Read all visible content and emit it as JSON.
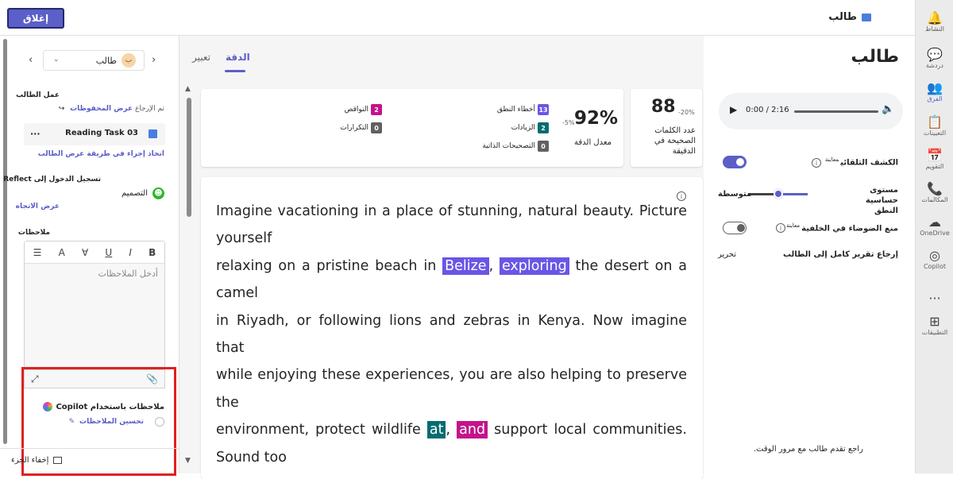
{
  "top_bar": {
    "close_label": "إغلاق",
    "app_title": "طالب"
  },
  "rail": [
    {
      "label": "النشاط",
      "icon": "bell-icon",
      "glyph": "🔔"
    },
    {
      "label": "دردشة",
      "icon": "chat-icon",
      "glyph": "💬"
    },
    {
      "label": "الفرق",
      "icon": "teams-icon",
      "glyph": "👥"
    },
    {
      "label": "التعيينات",
      "icon": "assignments-icon",
      "glyph": "📋"
    },
    {
      "label": "التقويم",
      "icon": "calendar-icon",
      "glyph": "📅"
    },
    {
      "label": "المكالمات",
      "icon": "phone-icon",
      "glyph": "📞"
    },
    {
      "label": "OneDrive",
      "icon": "cloud-icon",
      "glyph": "☁"
    },
    {
      "label": "Copilot",
      "icon": "copilot-icon",
      "glyph": "◎"
    },
    {
      "label": "",
      "icon": "more-icon",
      "glyph": "···"
    },
    {
      "label": "التطبيقات",
      "icon": "apps-icon",
      "glyph": "⊞"
    }
  ],
  "left_pane": {
    "student_name": "طالب",
    "avatar_glyph": "ب",
    "student_work_label": "عمل الطالب",
    "returned_text": "تم الإرجاع",
    "view_saved": "عرض المحفوظات",
    "task_name": "Reading Task 03",
    "task_more": "···",
    "take_action": "اتخاذ إجراء في طريقة عرض الطالب",
    "reflect_label": "تسجيل الدخول إلى Reflect",
    "reflect_value": "التصميم",
    "view_trend": "عرض الاتجاه",
    "notes_label": "ملاحظات",
    "notes_placeholder": "أدخل الملاحظات",
    "copilot_title": "ملاحظات باستخدام Copilot",
    "improve_notes": "تحسين الملاحظات",
    "hide_pane": "إخفاء الجزء"
  },
  "center": {
    "tabs": [
      "الدقة",
      "تعبير"
    ],
    "accuracy_value": "92%",
    "accuracy_delta": "-5%",
    "accuracy_label": "معدل الدقة",
    "errors": [
      {
        "label": "أخطاء النطق",
        "count": "13",
        "color": "#6956e5"
      },
      {
        "label": "الزيادات",
        "count": "2",
        "color": "#036c70"
      },
      {
        "label": "التصحيحات الذاتية",
        "count": "0",
        "color": "#616161"
      },
      {
        "label": "النواقص",
        "count": "2",
        "color": "#c4138a"
      },
      {
        "label": "التكرارات",
        "count": "0",
        "color": "#616161"
      }
    ],
    "wcpm_value": "88",
    "wcpm_delta": "-20%",
    "wcpm_label": "عدد الكلمات الصحيحة في الدقيقة",
    "passage_lines": [
      [
        {
          "t": "Imagine vacationing in a place of stunning, natural beauty. Picture"
        }
      ],
      [
        {
          "t": "yourself"
        }
      ],
      [
        {
          "t": "relaxing on a pristine beach in "
        },
        {
          "t": "Belize",
          "c": "p"
        },
        {
          "t": ", "
        },
        {
          "t": "exploring",
          "c": "p"
        },
        {
          "t": " the desert on a"
        }
      ],
      [
        {
          "t": "camel"
        }
      ],
      [
        {
          "t": "in Riyadh, or following lions and zebras in Kenya. Now imagine"
        }
      ],
      [
        {
          "t": "that"
        }
      ],
      [
        {
          "t": "while enjoying these experiences, you are also helping to preserve"
        }
      ],
      [
        {
          "t": "the"
        }
      ],
      [
        {
          "t": "environment, protect wildlife "
        },
        {
          "t": "at",
          "c": "t"
        },
        {
          "t": ", "
        },
        {
          "t": "and",
          "c": "m"
        },
        {
          "t": " support local communities."
        }
      ],
      [
        {
          "t": "Sound too"
        }
      ]
    ]
  },
  "right_col": {
    "page_title": "طالب",
    "audio_time": "0:00 / 2:16",
    "auto_detect_label": "الكشف التلقائي",
    "preview_tag": "معاينة",
    "sensitivity_label": "مستوى حساسية النطق",
    "sensitivity_value": "متوسطة",
    "noise_label": "منع الضوضاء في الخلفية",
    "return_report": "إرجاع تقرير كامل إلى الطالب",
    "edit_label": "تحرير",
    "progress_text": "راجع تقدم طالب مع مرور الوقت."
  }
}
